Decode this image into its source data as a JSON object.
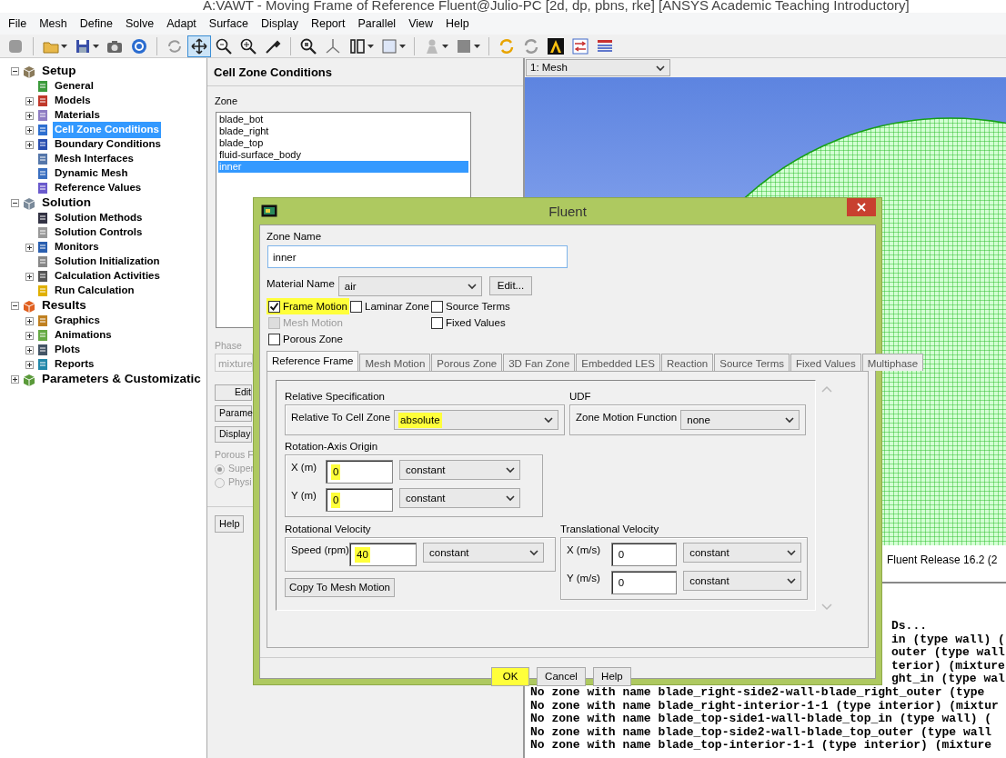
{
  "window": {
    "title": "A:VAWT - Moving Frame of Reference Fluent@Julio-PC  [2d, dp, pbns, rke] [ANSYS Academic Teaching Introductory]"
  },
  "menu": [
    "File",
    "Mesh",
    "Define",
    "Solve",
    "Adapt",
    "Surface",
    "Display",
    "Report",
    "Parallel",
    "View",
    "Help"
  ],
  "toolbar": [
    {
      "selected": false
    },
    {
      "selected": false
    },
    {
      "selected": false
    },
    {
      "selected": false
    },
    {
      "selected": false
    },
    {
      "selected": false
    },
    {
      "selected": true
    },
    {
      "selected": false
    },
    {
      "selected": false
    },
    {
      "selected": false
    },
    {
      "selected": false
    },
    {
      "selected": false
    },
    {
      "selected": false
    },
    {
      "selected": false
    },
    {
      "selected": false
    },
    {
      "selected": false
    },
    {
      "selected": false
    },
    {
      "selected": false
    },
    {
      "selected": false
    },
    {
      "selected": false
    },
    {
      "selected": false
    }
  ],
  "tree": [
    {
      "label": "Setup",
      "expanded": true,
      "selected": false,
      "children": [
        {
          "label": "General",
          "expander": false,
          "selected": false
        },
        {
          "label": "Models",
          "expander": true,
          "selected": false
        },
        {
          "label": "Materials",
          "expander": true,
          "selected": false
        },
        {
          "label": "Cell Zone Conditions",
          "expander": true,
          "selected": true
        },
        {
          "label": "Boundary Conditions",
          "expander": true,
          "selected": false
        },
        {
          "label": "Mesh Interfaces",
          "expander": false,
          "selected": false
        },
        {
          "label": "Dynamic Mesh",
          "expander": false,
          "selected": false
        },
        {
          "label": "Reference Values",
          "expander": false,
          "selected": false
        }
      ]
    },
    {
      "label": "Solution",
      "expanded": true,
      "selected": false,
      "children": [
        {
          "label": "Solution Methods",
          "expander": false,
          "selected": false
        },
        {
          "label": "Solution Controls",
          "expander": false,
          "selected": false
        },
        {
          "label": "Monitors",
          "expander": true,
          "selected": false
        },
        {
          "label": "Solution Initialization",
          "expander": false,
          "selected": false
        },
        {
          "label": "Calculation Activities",
          "expander": true,
          "selected": false
        },
        {
          "label": "Run Calculation",
          "expander": false,
          "selected": false
        }
      ]
    },
    {
      "label": "Results",
      "expanded": true,
      "selected": false,
      "children": [
        {
          "label": "Graphics",
          "expander": true,
          "selected": false
        },
        {
          "label": "Animations",
          "expander": true,
          "selected": false
        },
        {
          "label": "Plots",
          "expander": true,
          "selected": false
        },
        {
          "label": "Reports",
          "expander": true,
          "selected": false
        }
      ]
    },
    {
      "label": "Parameters & Customizatic",
      "expanded": false,
      "selected": false
    }
  ],
  "panel": {
    "title": "Cell Zone Conditions",
    "zone_label": "Zone",
    "zones": [
      {
        "label": "blade_bot",
        "selected": false
      },
      {
        "label": "blade_right",
        "selected": false
      },
      {
        "label": "blade_top",
        "selected": false
      },
      {
        "label": "fluid-surface_body",
        "selected": false
      },
      {
        "label": "inner",
        "selected": true
      }
    ],
    "phase_label": "Phase",
    "phase_value": "mixture",
    "buttons": [
      "Edit",
      "Parame",
      "Display"
    ],
    "porous_label": "Porous F",
    "porous_options": [
      {
        "label": "Super",
        "selected": true
      },
      {
        "label": "Physi",
        "selected": false
      }
    ],
    "help": "Help"
  },
  "graphics": {
    "view": "1: Mesh",
    "release": "Fluent Release 16.2 (2"
  },
  "console": [
    {
      "text": "Ds...",
      "clipped": true
    },
    {
      "text": "in (type wall) (",
      "clipped": true
    },
    {
      "text": "outer (type wall",
      "clipped": true
    },
    {
      "text": "terior) (mixture",
      "clipped": true
    },
    {
      "text": "ght_in (type wal",
      "clipped": true
    },
    {
      "text": "No zone with name blade_right-side2-wall-blade_right_outer (type",
      "clipped": false
    },
    {
      "text": "No zone with name blade_right-interior-1-1 (type interior) (mixtur",
      "clipped": false
    },
    {
      "text": "No zone with name blade_top-side1-wall-blade_top_in (type wall) (",
      "clipped": false
    },
    {
      "text": "No zone with name blade_top-side2-wall-blade_top_outer (type wall",
      "clipped": false
    },
    {
      "text": "No zone with name blade_top-interior-1-1 (type interior) (mixture",
      "clipped": false
    }
  ],
  "dialog": {
    "title": "Fluent",
    "zone_name_label": "Zone Name",
    "zone_name": "inner",
    "material_label": "Material Name",
    "material": "air",
    "material_edit": "Edit...",
    "option_columns": [
      [
        {
          "label": "Frame Motion",
          "checked": true,
          "disabled": false,
          "highlighted": true
        },
        {
          "label": "Mesh Motion",
          "checked": false,
          "disabled": true,
          "highlighted": false
        },
        {
          "label": "Porous Zone",
          "checked": false,
          "disabled": false,
          "highlighted": false
        }
      ],
      [
        {
          "label": "Laminar Zone",
          "checked": false,
          "disabled": false,
          "highlighted": false
        }
      ],
      [
        {
          "label": "Source Terms",
          "checked": false,
          "disabled": false,
          "highlighted": false
        },
        {
          "label": "Fixed Values",
          "checked": false,
          "disabled": false,
          "highlighted": false
        }
      ]
    ],
    "tabs": [
      {
        "label": "Reference Frame",
        "selected": true
      },
      {
        "label": "Mesh Motion",
        "selected": false
      },
      {
        "label": "Porous Zone",
        "selected": false
      },
      {
        "label": "3D Fan Zone",
        "selected": false
      },
      {
        "label": "Embedded LES",
        "selected": false
      },
      {
        "label": "Reaction",
        "selected": false
      },
      {
        "label": "Source Terms",
        "selected": false
      },
      {
        "label": "Fixed Values",
        "selected": false
      },
      {
        "label": "Multiphase",
        "selected": false
      }
    ],
    "relative_spec": {
      "title": "Relative Specification",
      "label": "Relative To Cell Zone",
      "value": "absolute",
      "highlighted": true
    },
    "udf": {
      "title": "UDF",
      "label": "Zone Motion Function",
      "value": "none",
      "highlighted": false
    },
    "origin": {
      "title": "Rotation-Axis Origin",
      "fields": [
        {
          "label": "X (m)",
          "value": "0",
          "profile": "constant",
          "highlighted": true
        },
        {
          "label": "Y (m)",
          "value": "0",
          "profile": "constant",
          "highlighted": true
        }
      ]
    },
    "rotation": {
      "title": "Rotational Velocity",
      "fields": [
        {
          "label": "Speed (rpm)",
          "value": "40",
          "profile": "constant",
          "highlighted": true
        }
      ],
      "button": "Copy To Mesh Motion"
    },
    "translation": {
      "title": "Translational Velocity",
      "fields": [
        {
          "label": "X (m/s)",
          "value": "0",
          "profile": "constant",
          "highlighted": false
        },
        {
          "label": "Y (m/s)",
          "value": "0",
          "profile": "constant",
          "highlighted": false
        }
      ]
    },
    "buttons": [
      {
        "label": "OK",
        "highlighted": true
      },
      {
        "label": "Cancel",
        "highlighted": false
      },
      {
        "label": "Help",
        "highlighted": false
      }
    ]
  }
}
